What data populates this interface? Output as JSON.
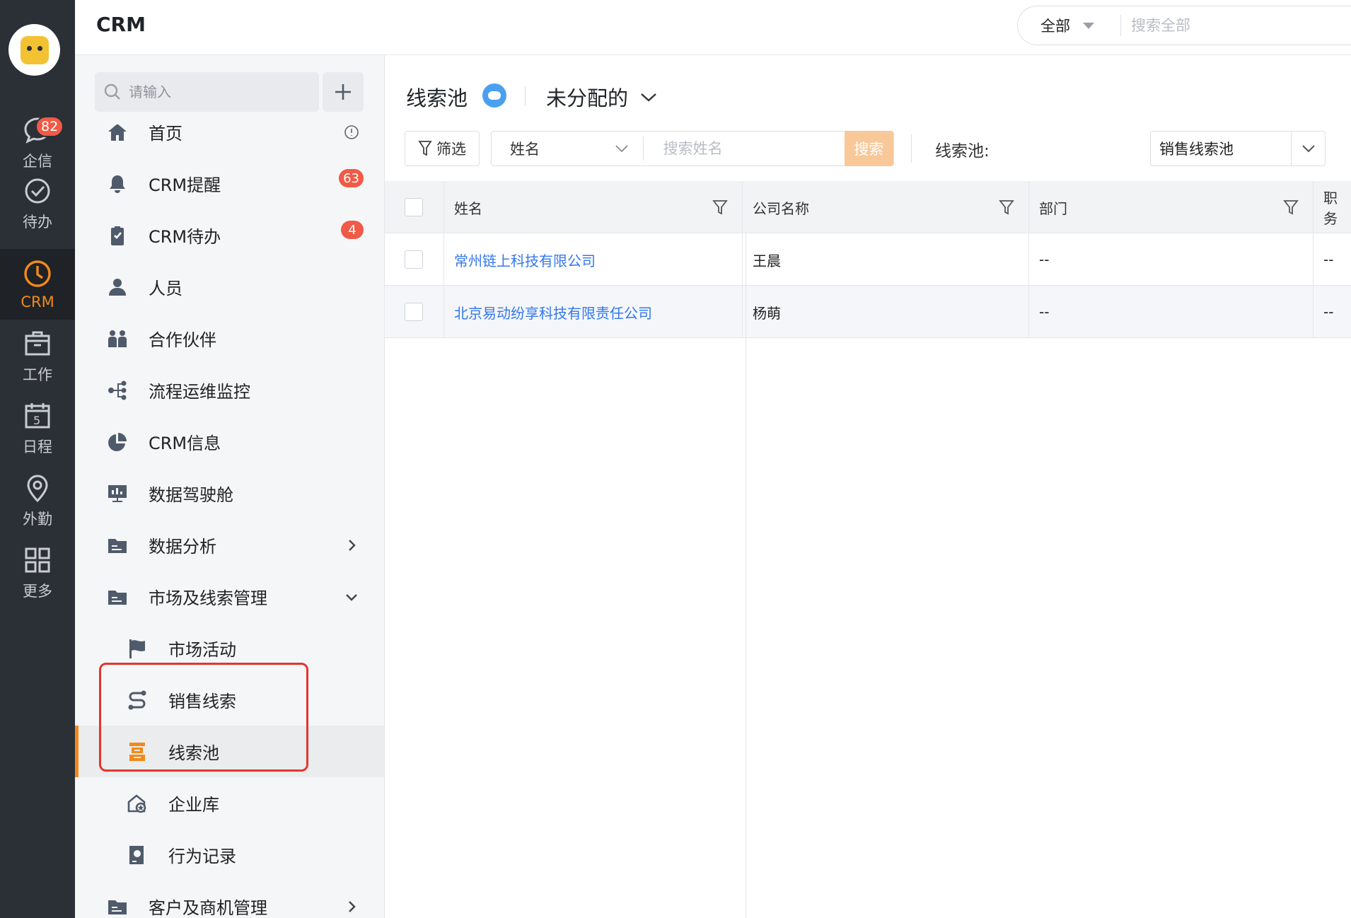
{
  "rail": {
    "items": [
      {
        "label": "企信",
        "icon": "chat-bubble-icon",
        "badge": "82"
      },
      {
        "label": "待办",
        "icon": "check-circle-icon"
      },
      {
        "label": "CRM",
        "icon": "clock-icon"
      },
      {
        "label": "工作",
        "icon": "briefcase-icon"
      },
      {
        "label": "日程",
        "icon": "calendar-icon",
        "day": "5"
      },
      {
        "label": "外勤",
        "icon": "location-pin-icon"
      },
      {
        "label": "更多",
        "icon": "grid-icon"
      }
    ],
    "active_index": 2,
    "accent": "#f28a1a"
  },
  "header": {
    "title": "CRM",
    "search_scope": "全部",
    "search_placeholder": "搜索全部"
  },
  "sidebar": {
    "search_placeholder": "请输入",
    "nav": [
      {
        "label": "首页",
        "icon": "home-icon"
      },
      {
        "label": "CRM提醒",
        "icon": "bell-icon",
        "badge": "63"
      },
      {
        "label": "CRM待办",
        "icon": "clipboard-check-icon",
        "badge": "4"
      },
      {
        "label": "人员",
        "icon": "person-icon"
      },
      {
        "label": "合作伙伴",
        "icon": "partners-icon"
      },
      {
        "label": "流程运维监控",
        "icon": "flow-icon"
      },
      {
        "label": "CRM信息",
        "icon": "pie-chart-icon"
      },
      {
        "label": "数据驾驶舱",
        "icon": "dashboard-screen-icon"
      },
      {
        "label": "数据分析",
        "icon": "folder-icon",
        "expand": "right"
      },
      {
        "label": "市场及线索管理",
        "icon": "folder-icon",
        "expand": "down"
      },
      {
        "label": "市场活动",
        "icon": "flag-icon",
        "sub": true
      },
      {
        "label": "销售线索",
        "icon": "route-icon",
        "sub": true
      },
      {
        "label": "线索池",
        "icon": "lead-pool-icon",
        "sub": true,
        "active": true
      },
      {
        "label": "企业库",
        "icon": "company-library-icon",
        "sub": true
      },
      {
        "label": "行为记录",
        "icon": "behavior-record-icon",
        "sub": true
      },
      {
        "label": "客户及商机管理",
        "icon": "folder-icon",
        "expand": "right"
      }
    ]
  },
  "main": {
    "title": "线索池",
    "view": "未分配的",
    "filter_label": "筛选",
    "search_field": "姓名",
    "search_placeholder": "搜索姓名",
    "search_button": "搜索",
    "pool_label": "线索池:",
    "pool_value": "销售线索池",
    "columns": [
      "姓名",
      "公司名称",
      "部门",
      "职务"
    ],
    "rows": [
      {
        "name": "常州链上科技有限公司",
        "company": "王晨",
        "dept": "--",
        "position": "--"
      },
      {
        "name": "北京易动纷享科技有限责任公司",
        "company": "杨萌",
        "dept": "--",
        "position": "--"
      }
    ],
    "link_color": "#3377ee",
    "search_button_color": "#f8c898"
  }
}
